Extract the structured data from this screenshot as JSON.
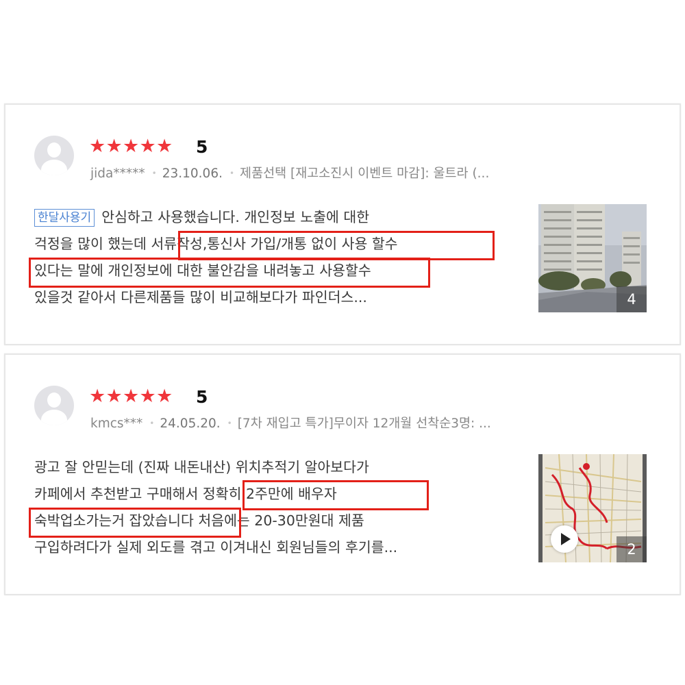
{
  "reviews": [
    {
      "score": "5",
      "user": "jida*****",
      "date": "23.10.06.",
      "option": "제품선택 [재고소진시 이벤트 마감]: 울트라 (...",
      "tag": "한달사용기",
      "lines": [
        "안심하고 사용했습니다. 개인정보 노출에 대한",
        "걱정을 많이 했는데 서류작성,통신사 가입/개통 없이 사용 할수",
        "있다는 말에 개인정보에 대한 불안감을 내려놓고 사용할수",
        "있을것 같아서 다른제품들 많이 비교해보다가 파인더스..."
      ],
      "photo_count": "4"
    },
    {
      "score": "5",
      "user": "kmcs***",
      "date": "24.05.20.",
      "option": "[7차 재입고 특가]무이자 12개월 선착순3명: ...",
      "lines": [
        "광고 잘 안믿는데 (진짜 내돈내산) 위치추적기 알아보다가",
        "카페에서 추천받고 구매해서 정확히 2주만에 배우자",
        "숙박업소가는거 잡았습니다  처음에는 20-30만원대 제품",
        "구입하려다가 실제 외도를 겪고 이겨내신 회원님들의 후기를..."
      ],
      "photo_count": "2"
    }
  ],
  "colors": {
    "star": "#f0363b",
    "highlight": "#e32018",
    "tag": "#4a82d2"
  },
  "icons": [
    "star-icon",
    "user-avatar-icon",
    "play-icon"
  ]
}
